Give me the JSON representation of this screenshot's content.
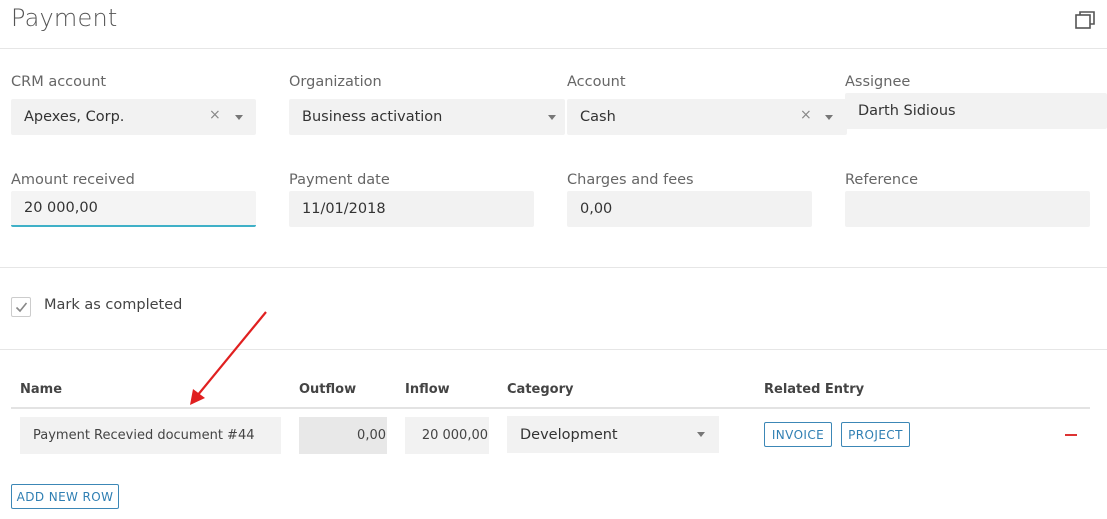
{
  "page": {
    "title": "Payment"
  },
  "fields": {
    "crm_account": {
      "label": "CRM account",
      "value": "Apexes, Corp.",
      "clear": "×"
    },
    "organization": {
      "label": "Organization",
      "value": "Business activation"
    },
    "account": {
      "label": "Account",
      "value": "Cash",
      "clear": "×"
    },
    "assignee": {
      "label": "Assignee",
      "value": "Darth Sidious"
    },
    "amount_received": {
      "label": "Amount received",
      "value": "20 000,00"
    },
    "payment_date": {
      "label": "Payment date",
      "value": "11/01/2018"
    },
    "charges_fees": {
      "label": "Charges and fees",
      "value": "0,00"
    },
    "reference": {
      "label": "Reference",
      "value": ""
    }
  },
  "mark_completed": {
    "label": "Mark as completed",
    "checked": true
  },
  "table": {
    "headers": {
      "name": "Name",
      "outflow": "Outflow",
      "inflow": "Inflow",
      "category": "Category",
      "related": "Related Entry"
    },
    "rows": [
      {
        "name": "Payment Recevied document #44",
        "outflow": "0,00",
        "inflow": "20 000,00",
        "category": "Development",
        "related": [
          "INVOICE",
          "PROJECT"
        ]
      }
    ]
  },
  "actions": {
    "add_row": "ADD NEW ROW"
  },
  "colors": {
    "accent": "#3fb0c7",
    "button": "#2f7fb3",
    "remove": "#dd3333",
    "annotation": "#e02020"
  }
}
